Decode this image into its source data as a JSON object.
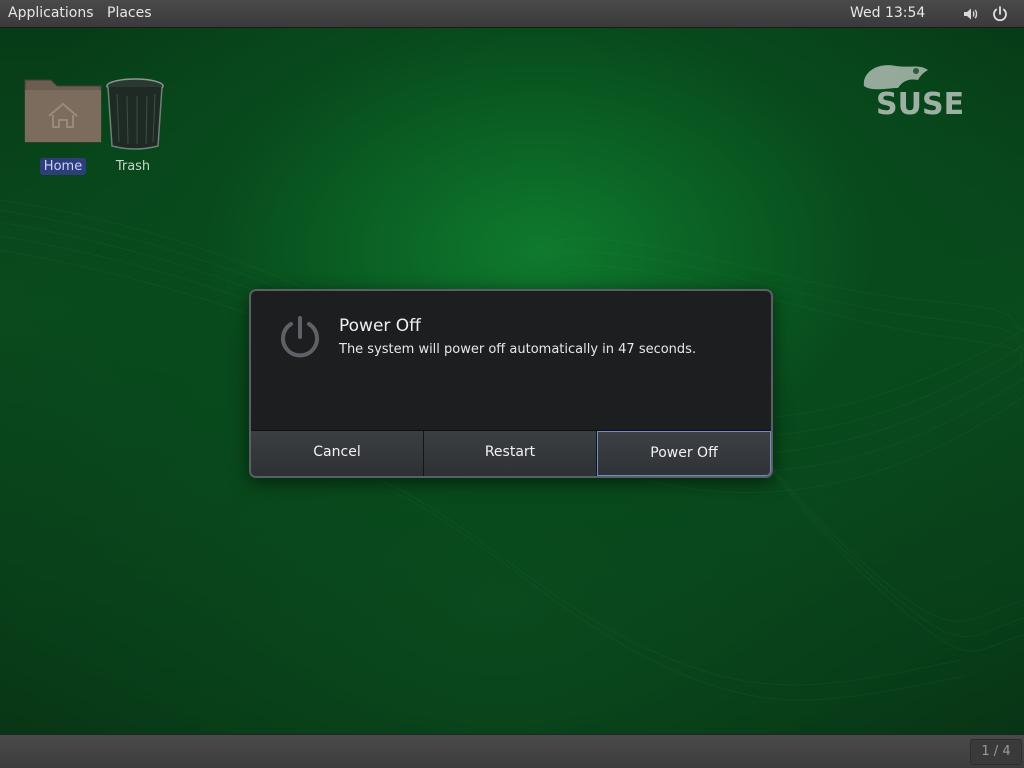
{
  "topbar": {
    "applications_label": "Applications",
    "places_label": "Places",
    "clock": "Wed 13:54",
    "volume_icon": "volume-icon",
    "power_icon": "power-icon"
  },
  "desktop": {
    "icons": [
      {
        "label": "Home",
        "icon": "home-folder-icon",
        "selected": true
      },
      {
        "label": "Trash",
        "icon": "trash-icon",
        "selected": false
      }
    ],
    "logo": "suse-logo"
  },
  "dialog": {
    "icon": "power-icon",
    "title": "Power Off",
    "message": "The system will power off automatically in 47 seconds.",
    "countdown_seconds": 47,
    "buttons": {
      "cancel": "Cancel",
      "restart": "Restart",
      "power_off": "Power Off"
    },
    "default_button": "power_off"
  },
  "bottombar": {
    "workspace": "1 / 4"
  },
  "colors": {
    "desktop_green": "#0a5e23",
    "panel": "#3f3f3f",
    "dialog_bg": "#1c1e20",
    "focus_border": "#6f8ec9",
    "selection": "#2d3e7a"
  }
}
